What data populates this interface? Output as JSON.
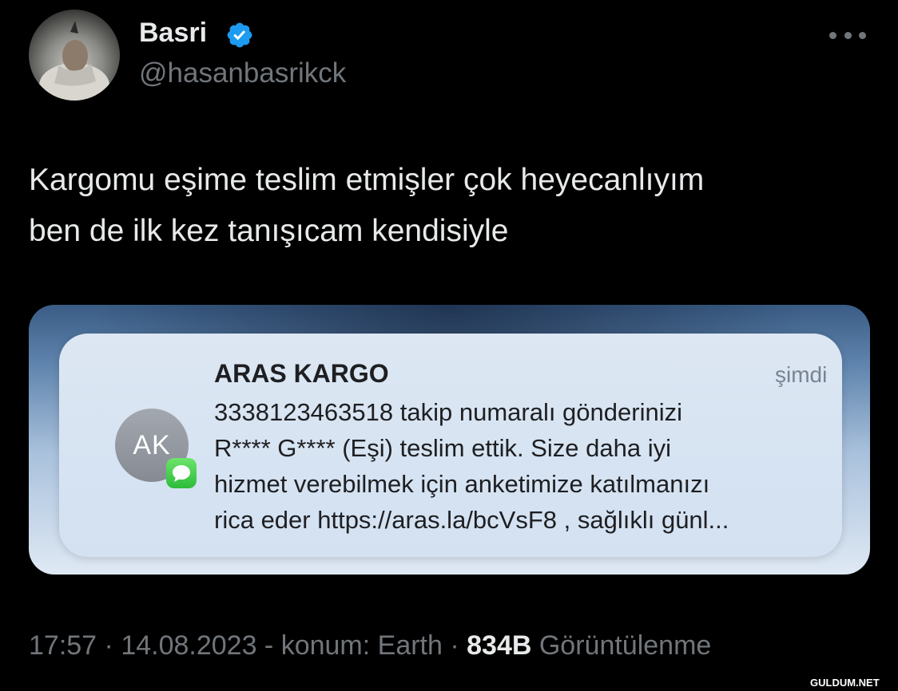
{
  "user": {
    "display_name": "Basri",
    "handle": "@hasanbasrikck",
    "verified": true
  },
  "tweet": {
    "text_lines": [
      "Kargomu eşime teslim etmişler çok heyecanlıyım",
      "ben de ilk kez tanışıcam kendisiyle"
    ]
  },
  "notification": {
    "avatar_initials": "AK",
    "sender": "ARAS KARGO",
    "time": "şimdi",
    "body_lines": [
      "3338123463518 takip numaralı gönderinizi",
      "R**** G**** (Eşi) teslim ettik. Size daha iyi",
      "hizmet verebilmek için anketimize katılmanızı",
      "rica eder https://aras.la/bcVsF8 , sağlıklı günl..."
    ]
  },
  "footer": {
    "time": "17:57",
    "separator": " · ",
    "date": "14.08.2023",
    "location": " - konum: Earth",
    "views_count": "834B",
    "views_label": " Görüntülenme"
  },
  "watermark": "GULDUM.NET",
  "colors": {
    "background": "#000000",
    "primary_text": "#e7e9ea",
    "secondary_text": "#71767b",
    "verified_blue": "#1d9bf0",
    "imessage_green": "#34c759"
  },
  "icons": {
    "verified": "verified-badge-icon",
    "more": "more-horizontal-icon",
    "messages": "messages-app-icon"
  }
}
